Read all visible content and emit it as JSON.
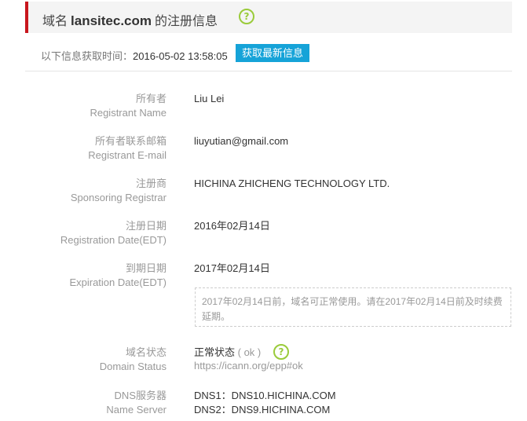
{
  "header": {
    "prefix": "域名",
    "domain": "lansitec.com",
    "suffix": "的注册信息",
    "help_icon": "question-circle-icon"
  },
  "update": {
    "label": "以下信息获取时间：",
    "time": "2016-05-02 13:58:05",
    "refresh_label": "获取最新信息"
  },
  "fields": {
    "registrant_name": {
      "label_cn": "所有者",
      "label_en": "Registrant Name",
      "value": "Liu Lei"
    },
    "registrant_email": {
      "label_cn": "所有者联系邮箱",
      "label_en": "Registrant E-mail",
      "value": "liuyutian@gmail.com"
    },
    "registrar": {
      "label_cn": "注册商",
      "label_en": "Sponsoring Registrar",
      "value": "HICHINA ZHICHENG TECHNOLOGY LTD."
    },
    "registration_date": {
      "label_cn": "注册日期",
      "label_en": "Registration Date(EDT)",
      "value": "2016年02月14日"
    },
    "expiration_date": {
      "label_cn": "到期日期",
      "label_en": "Expiration Date(EDT)",
      "value": "2017年02月14日",
      "note": "2017年02月14日前，域名可正常使用。请在2017年02月14日前及时续费延期。"
    },
    "domain_status": {
      "label_cn": "域名状态",
      "label_en": "Domain Status",
      "status_text": "正常状态",
      "status_code": "( ok )",
      "link": "https://icann.org/epp#ok",
      "help_icon": "question-circle-icon"
    },
    "name_server": {
      "label_cn": "DNS服务器",
      "label_en": "Name Server",
      "dns1": "DNS1：DNS10.HICHINA.COM",
      "dns2": "DNS2：DNS9.HICHINA.COM"
    }
  },
  "colors": {
    "accent_red": "#c8161d",
    "button_blue": "#16a3d8",
    "icon_green": "#9acb3a"
  }
}
